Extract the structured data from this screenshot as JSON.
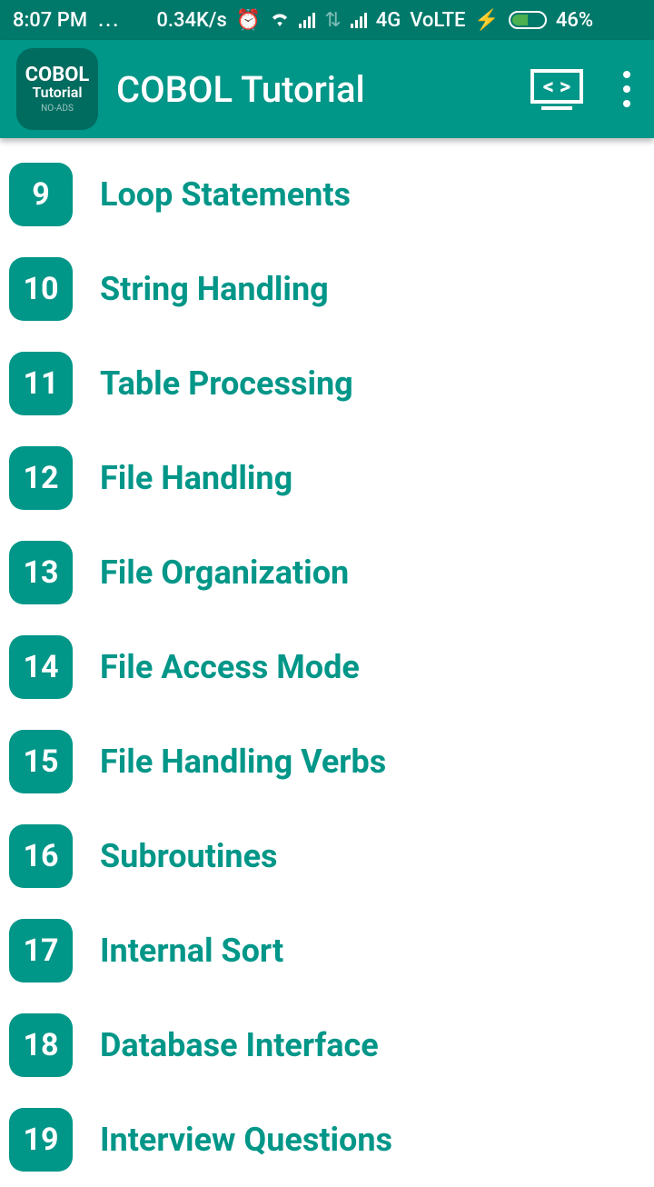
{
  "status": {
    "time": "8:07 PM",
    "notif": "...",
    "speed": "0.34K/s",
    "net": "4G",
    "volte": "VoLTE",
    "battery": "46%"
  },
  "header": {
    "title": "COBOL Tutorial",
    "icon_l1": "COBOL",
    "icon_l2": "Tutorial",
    "icon_l3": "NO-ADS"
  },
  "items": [
    {
      "n": "9",
      "label": "Loop Statements"
    },
    {
      "n": "10",
      "label": "String Handling"
    },
    {
      "n": "11",
      "label": "Table Processing"
    },
    {
      "n": "12",
      "label": "File Handling"
    },
    {
      "n": "13",
      "label": "File Organization"
    },
    {
      "n": "14",
      "label": "File Access Mode"
    },
    {
      "n": "15",
      "label": "File Handling Verbs"
    },
    {
      "n": "16",
      "label": "Subroutines"
    },
    {
      "n": "17",
      "label": "Internal Sort"
    },
    {
      "n": "18",
      "label": "Database Interface"
    },
    {
      "n": "19",
      "label": "Interview Questions"
    }
  ]
}
